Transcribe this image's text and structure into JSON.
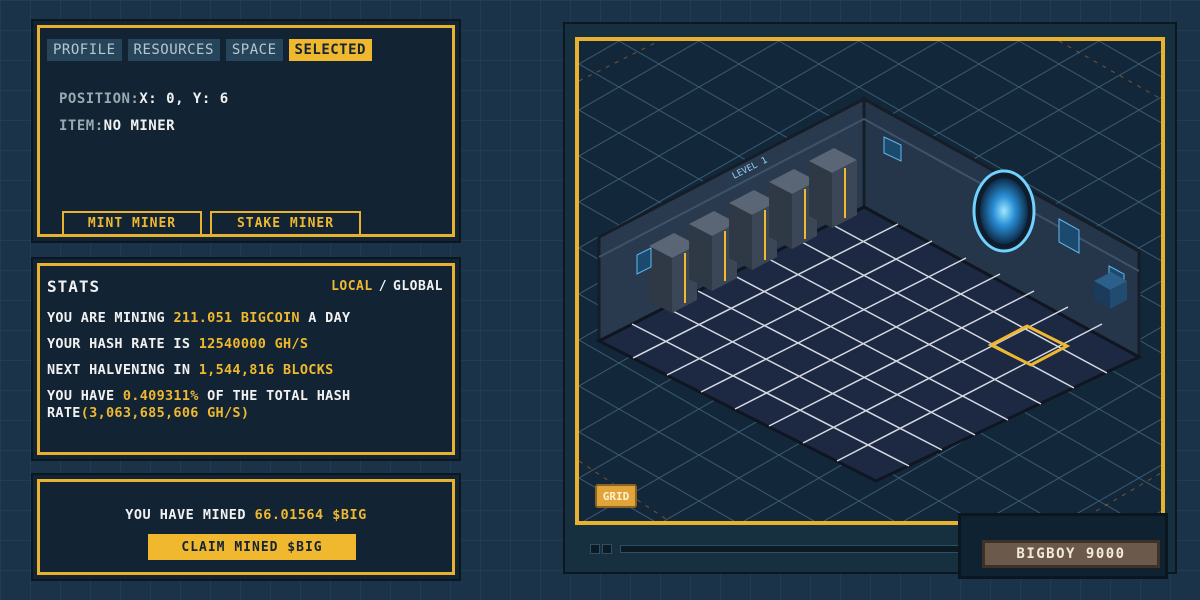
{
  "selection_panel": {
    "tabs": [
      {
        "label": "PROFILE",
        "active": false
      },
      {
        "label": "RESOURCES",
        "active": false
      },
      {
        "label": "SPACE",
        "active": false
      },
      {
        "label": "SELECTED",
        "active": true
      }
    ],
    "position_label": "POSITION:",
    "position_value": "X: 0, Y: 6",
    "item_label": "ITEM:",
    "item_value": "NO MINER",
    "mint_button": "MINT MINER",
    "stake_button": "STAKE MINER"
  },
  "stats_panel": {
    "title": "STATS",
    "toggle_local": "LOCAL",
    "toggle_separator": "/",
    "toggle_global": "GLOBAL",
    "line1_prefix": "YOU ARE MINING",
    "line1_value": "211.051 BIGCOIN",
    "line1_suffix": "A DAY",
    "line2_prefix": "YOUR HASH RATE IS",
    "line2_value": "12540000 GH/S",
    "line3_prefix": "NEXT HALVENING IN",
    "line3_value": "1,544,816 BLOCKS",
    "line4_prefix": "YOU HAVE",
    "line4_value": "0.409311%",
    "line4_suffix": "OF THE TOTAL HASH",
    "line5_prefix": "RATE",
    "line5_value": "(3,063,685,606 GH/S)"
  },
  "claim_panel": {
    "mined_prefix": "YOU HAVE MINED",
    "mined_value": "66.01564 $BIG",
    "claim_button": "CLAIM MINED $BIG"
  },
  "game_view": {
    "room_sign": "LEVEL 1",
    "grid_button": "GRID",
    "nameplate": "BIGBOY 9000"
  },
  "colors": {
    "accent": "#f0b82f",
    "background": "#1a3348",
    "panel": "#122433"
  }
}
